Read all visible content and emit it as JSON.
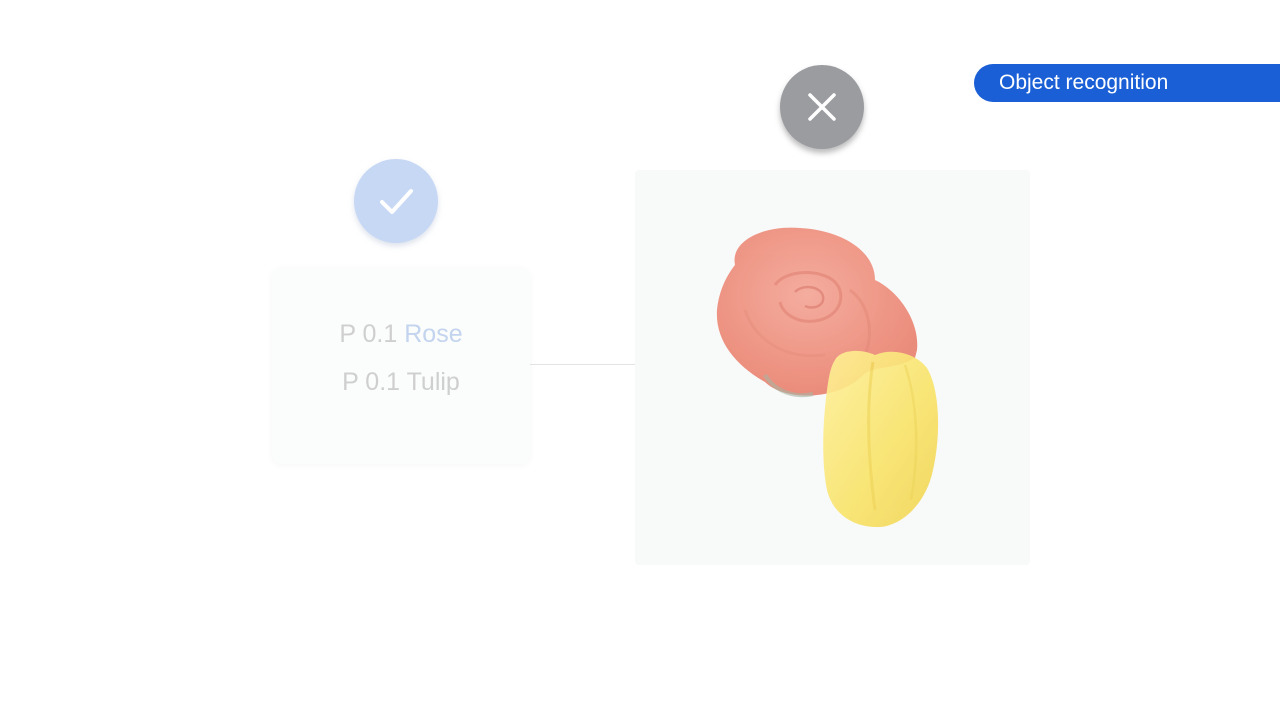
{
  "badge": {
    "label": "Object recognition",
    "color": "#1a5fd6"
  },
  "status_icons": {
    "accept_icon": "check-icon",
    "reject_icon": "close-icon"
  },
  "predictions": [
    {
      "prefix": "P 0.1",
      "label": "Rose",
      "label_color": "#c3d4ee"
    },
    {
      "prefix": "P 0.1",
      "label": "Tulip",
      "label_color": "#cfcfcf"
    }
  ],
  "image": {
    "subjects": [
      "rose",
      "tulip"
    ]
  }
}
